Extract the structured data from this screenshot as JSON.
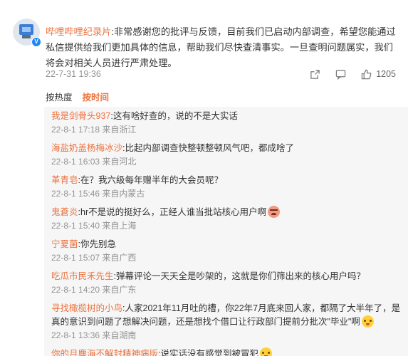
{
  "main_comment": {
    "author": "哔哩哔哩纪录片",
    "text": ":非常感谢您的批评与反馈，目前我们已启动内部调查，希望您能通过私信提供给我们更加具体的信息，帮助我们尽快查清事实。一旦查明问题属实，我们将会对相关人员进行严肃处理。",
    "time": "22-7-31 19:36",
    "like_count": "1205",
    "icons": [
      "share-icon",
      "comment-icon",
      "like-icon"
    ]
  },
  "sort": {
    "hot": "按热度",
    "time": "按时间"
  },
  "replies": [
    {
      "name": "我是剑骨头937",
      "text": ":这有啥好查的，说的不是大实话",
      "meta": "22-8-1 17:18 来自浙江"
    },
    {
      "name": "海盐奶盖杨梅冰沙",
      "text": ":比起内部调查快整顿整顿风气吧，都成啥了",
      "meta": "22-8-1 16:03 来自河北"
    },
    {
      "name": "革青皂",
      "text": ":在？我六级每年赠半年的大会员呢？",
      "meta": "22-8-1 15:46 来自内蒙古"
    },
    {
      "name": "鬼蒼炎",
      "text": ":hr不是说的挺好么，正经人谁当批站核心用户啊",
      "emoji": "angry",
      "meta": "22-8-1 15:40 来自上海"
    },
    {
      "name": "宁夏菌",
      "text": ":你先别急",
      "meta": "22-8-1 15:07 来自广西"
    },
    {
      "name": "吃瓜市民禾先生",
      "text": ":弹幕评论一天天全是吵架的，这就是你们筛出来的核心用户吗？",
      "meta": "22-8-1 14:20 来自广东"
    },
    {
      "name": "寻找橄榄树的小鸟",
      "text": ":人家2021年11月吐的槽，你22年7月底来回人家，都隔了大半年了，是真的意识到问题了想解决问题，还是想找个借口让行政部门提前分批次\"毕业\"啊",
      "emoji": "shy",
      "meta": "22-8-1 13:36 来自湖南"
    },
    {
      "name": "你的月塵海不解封精神病版",
      "text": ":说实话没有感觉到被冒犯",
      "emoji": "shy",
      "meta": ""
    }
  ]
}
